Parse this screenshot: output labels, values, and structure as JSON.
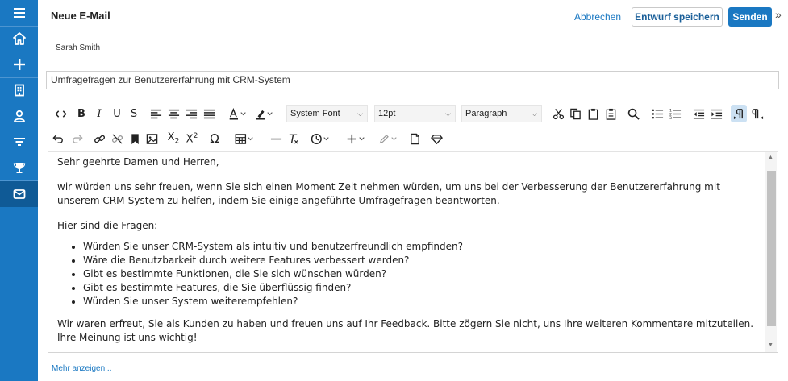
{
  "sidebar": {
    "items": [
      {
        "icon": "menu-icon"
      },
      {
        "icon": "home-icon"
      },
      {
        "icon": "plus-icon"
      },
      {
        "icon": "building-icon"
      },
      {
        "icon": "contact-icon"
      },
      {
        "icon": "filter-icon"
      },
      {
        "icon": "trophy-icon"
      },
      {
        "icon": "mail-icon",
        "active": true
      }
    ],
    "bg_color": "#1a78c2",
    "active_color": "#0f5a96"
  },
  "header": {
    "title": "Neue E-Mail",
    "cancel_label": "Abbrechen",
    "draft_label": "Entwurf speichern",
    "send_label": "Senden",
    "expand_icon": "»"
  },
  "sender": "Sarah Smith",
  "subject": "Umfragefragen zur Benutzererfahrung mit CRM-System",
  "toolbar": {
    "font_family": "System Font",
    "font_size": "12pt",
    "block_format": "Paragraph",
    "omega": "Ω"
  },
  "body": {
    "greeting": "Sehr geehrte Damen und Herren,",
    "intro": "wir würden uns sehr freuen, wenn Sie sich einen Moment Zeit nehmen würden, um uns bei der Verbesserung der Benutzererfahrung mit unserem CRM-System zu helfen, indem Sie einige angeführte Umfragefragen beantworten.",
    "questions_heading": "Hier sind die Fragen:",
    "questions": [
      "Würden Sie unser CRM-System als intuitiv und benutzerfreundlich empfinden?",
      "Wäre die Benutzbarkeit durch weitere Features verbessert werden?",
      "Gibt es bestimmte Funktionen, die Sie sich wünschen würden?",
      "Gibt es bestimmte Features, die Sie überflüssig finden?",
      "Würden Sie unser System weiterempfehlen?"
    ],
    "closing": "Wir waren erfreut, Sie als Kunden zu haben und freuen uns auf Ihr Feedback. Bitte zögern Sie nicht, uns Ihre weiteren Kommentare mitzuteilen. Ihre Meinung ist uns wichtig!"
  },
  "show_more": "Mehr anzeigen...",
  "colors": {
    "accent": "#1a78c2",
    "active_toggle": "#cce1f3"
  }
}
